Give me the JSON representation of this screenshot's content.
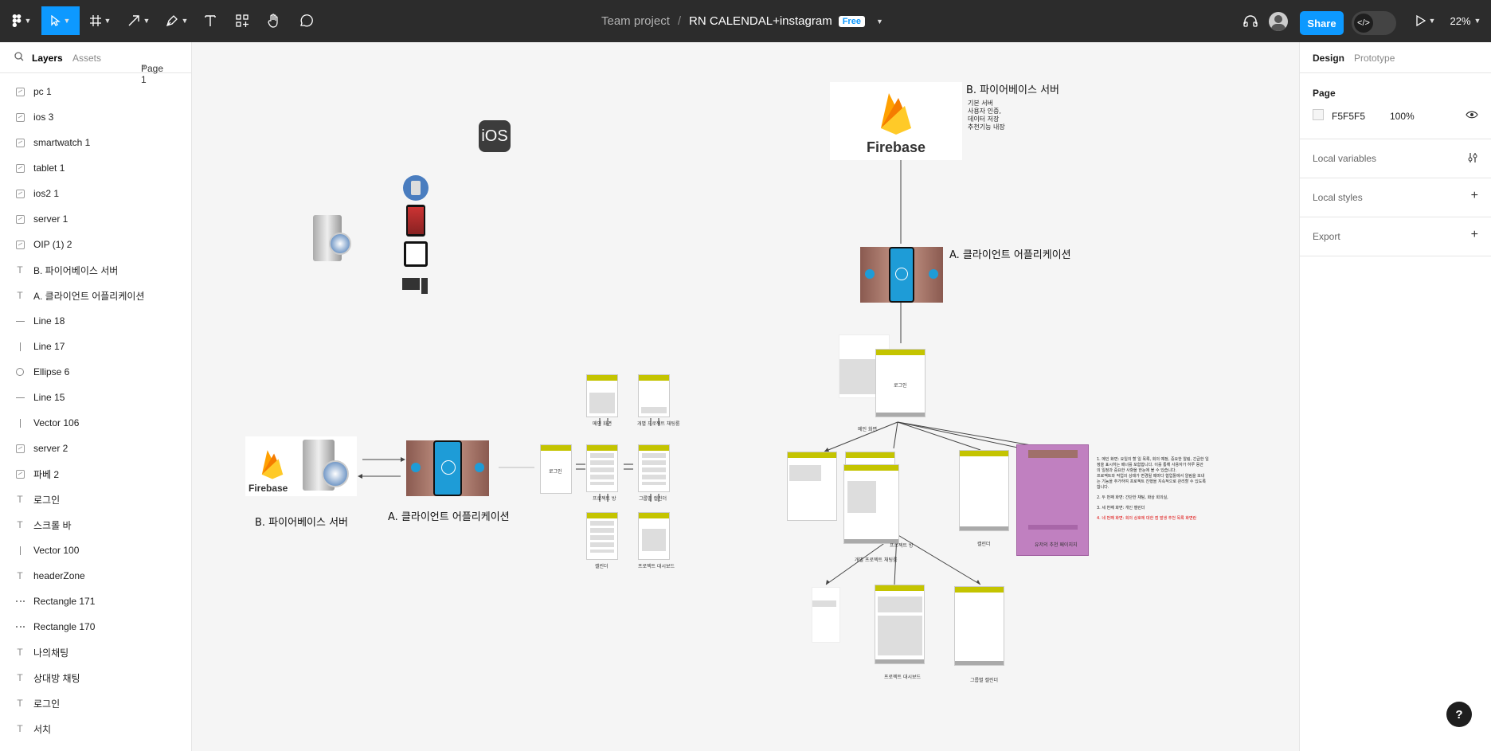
{
  "toolbar": {
    "breadcrumb_team": "Team project",
    "breadcrumb_sep": "/",
    "file_name": "RN CALENDAL+instagram",
    "plan_badge": "Free",
    "share_label": "Share",
    "zoom": "22%"
  },
  "left_panel": {
    "tab_layers": "Layers",
    "tab_assets": "Assets",
    "page_selector": "Page 1",
    "layers": [
      {
        "icon": "image",
        "label": "pc 1"
      },
      {
        "icon": "image",
        "label": "ios 3"
      },
      {
        "icon": "image",
        "label": "smartwatch 1"
      },
      {
        "icon": "image",
        "label": "tablet 1"
      },
      {
        "icon": "image",
        "label": "ios2 1"
      },
      {
        "icon": "image",
        "label": "server 1"
      },
      {
        "icon": "image",
        "label": "OIP (1) 2"
      },
      {
        "icon": "text",
        "label": "B. 파이어베이스 서버"
      },
      {
        "icon": "text",
        "label": "A. 클라이언트 어플리케이션"
      },
      {
        "icon": "line",
        "label": "Line 18"
      },
      {
        "icon": "vline",
        "label": "Line 17"
      },
      {
        "icon": "ellipse",
        "label": "Ellipse 6"
      },
      {
        "icon": "line",
        "label": "Line 15"
      },
      {
        "icon": "vline",
        "label": "Vector 106"
      },
      {
        "icon": "image",
        "label": "server 2"
      },
      {
        "icon": "image",
        "label": "파베 2"
      },
      {
        "icon": "text",
        "label": "로그인"
      },
      {
        "icon": "text",
        "label": "스크롤 바"
      },
      {
        "icon": "vline",
        "label": "Vector 100"
      },
      {
        "icon": "text",
        "label": "headerZone"
      },
      {
        "icon": "dash",
        "label": "Rectangle 171"
      },
      {
        "icon": "dash",
        "label": "Rectangle 170"
      },
      {
        "icon": "text",
        "label": "나의채팅"
      },
      {
        "icon": "text",
        "label": "상대방 채팅"
      },
      {
        "icon": "text",
        "label": "로그인"
      },
      {
        "icon": "text",
        "label": "서치"
      }
    ]
  },
  "right_panel": {
    "tab_design": "Design",
    "tab_prototype": "Prototype",
    "page_heading": "Page",
    "page_color": "F5F5F5",
    "page_opacity": "100%",
    "local_variables": "Local variables",
    "local_styles": "Local styles",
    "export": "Export"
  },
  "canvas": {
    "ios_badge": "iOS",
    "firebase_word": "Firebase",
    "firebase_word_small": "Firebase",
    "server_title_top": "B. 파이어베이스 서버",
    "server_notes": [
      "기본 서버",
      "사용자 인증,",
      "데이터 저장",
      "추천기능 내장"
    ],
    "client_title_top": "A. 클라이언트 어플리케이션",
    "server_title_bottom": "B. 파이어베이스 서버",
    "client_title_bottom": "A. 클라이언트 어플리케이션",
    "flow_labels": [
      "로그인",
      "메인 화면",
      "개별 프로젝트 채팅룸",
      "프로젝트 방",
      "그룹별 캘린더",
      "캘린더",
      "프로젝트 대시보드"
    ],
    "tree_labels": [
      "로그인",
      "메인 화면",
      "프로젝트 방",
      "캘린더",
      "유저의 추천 페이지지",
      "개별 프로젝트 채팅룸",
      "프로젝트 대시보드",
      "그룹별 캘린더"
    ],
    "notes": [
      "1. 메인 화면: 요일의 할 일 목록, 회의 예정, 중요한 알림, 긴급한 일",
      "정을 표시하는 배너를 포함합니다. 이를 통해 사용자가 하루 동안",
      "의 일정과 중요한 사항을 한눈에 볼 수 있습니다.",
      "프로젝트와 작업의 상태가 변경될 때마다 협업툴에서 알림을 보내",
      "는 기능을 추가하여 프로젝트 진행을 지속적으로 관리할 수 있도록",
      "합니다.",
      "2. 두 번째 화면: 간단한 채팅, 화상 회의실,",
      "3. 세 번째 화면: 개인 캘린더",
      "4. 네 번째 화면: 회의 상호에 대한 점 발생 추천 목록 화면란"
    ]
  },
  "colors": {
    "accent": "#0d99ff",
    "wire_header": "#c4c400",
    "recommend_page": "#c080c0"
  }
}
